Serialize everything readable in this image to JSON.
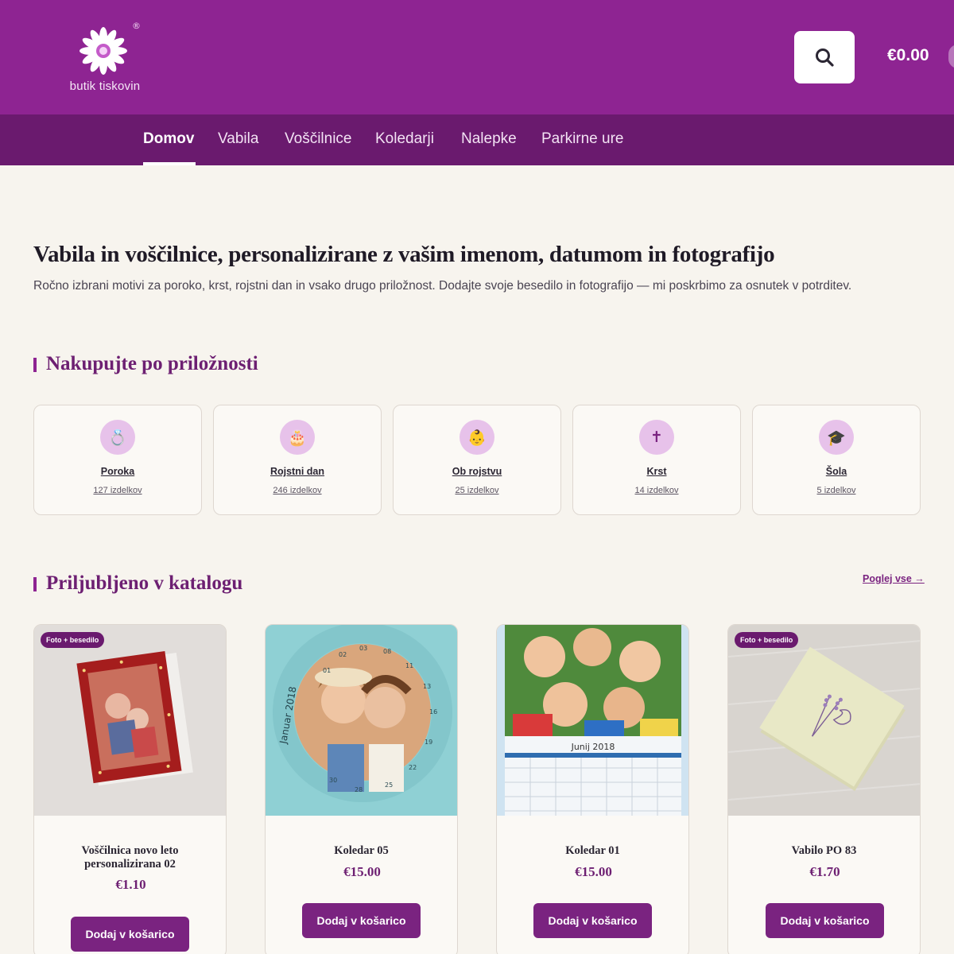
{
  "header": {
    "logo_text": "butik tiskovin",
    "logo_mark": "®",
    "cart_total": "€0.00",
    "icons": {
      "search": "search-icon",
      "logo": "flower-logo-icon"
    },
    "brand_color": "#8e2492",
    "nav_color": "#6a1a6e"
  },
  "nav": {
    "items": [
      {
        "label": "Domov",
        "active": true
      },
      {
        "label": "Vabila"
      },
      {
        "label": "Voščilnice"
      },
      {
        "label": "Koledarji"
      },
      {
        "label": "Nalepke"
      },
      {
        "label": "Parkirne ure"
      }
    ]
  },
  "hero": {
    "title": "Vabila in voščilnice, personalizirane z vašim imenom, datumom in fotografijo",
    "subtitle": "Ročno izbrani motivi za poroko, krst, rojstni dan in vsako drugo priložnost. Dodajte svoje besedilo in fotografijo — mi poskrbimo za osnutek v potrditev."
  },
  "occasions": {
    "title": "Nakupujte po priložnosti",
    "items": [
      {
        "name": "Poroka",
        "count": "127 izdelkov",
        "icon": "ring-icon",
        "glyph": "💍"
      },
      {
        "name": "Rojstni dan",
        "count": "246 izdelkov",
        "icon": "cake-icon",
        "glyph": "🎂"
      },
      {
        "name": "Ob rojstvu",
        "count": "25 izdelkov",
        "icon": "baby-icon",
        "glyph": "👶"
      },
      {
        "name": "Krst",
        "count": "14 izdelkov",
        "icon": "cross-icon",
        "glyph": "✝"
      },
      {
        "name": "Šola",
        "count": "5 izdelkov",
        "icon": "graduation-cap-icon",
        "glyph": "🎓"
      }
    ]
  },
  "catalog": {
    "title": "Priljubljeno v katalogu",
    "view_all": "Poglej vse →",
    "products": [
      {
        "name": "Voščilnica novo leto personalizirana 02",
        "price": "€1.10",
        "badge": "Foto + besedilo",
        "button": "Dodaj v košarico"
      },
      {
        "name": "Koledar 05",
        "price": "€15.00",
        "button": "Dodaj v košarico",
        "img_text": "Januar 2018"
      },
      {
        "name": "Koledar 01",
        "price": "€15.00",
        "button": "Dodaj v košarico",
        "img_text": "Junij 2018"
      },
      {
        "name": "Vabilo PO 83",
        "price": "€1.70",
        "badge": "Foto + besedilo",
        "button": "Dodaj v košarico"
      }
    ]
  }
}
